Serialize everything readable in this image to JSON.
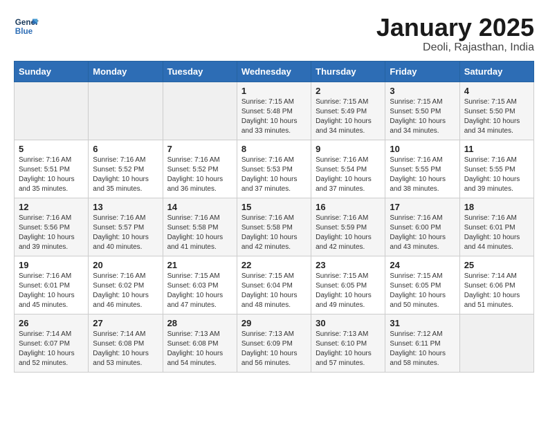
{
  "header": {
    "logo_line1": "General",
    "logo_line2": "Blue",
    "title": "January 2025",
    "location": "Deoli, Rajasthan, India"
  },
  "weekdays": [
    "Sunday",
    "Monday",
    "Tuesday",
    "Wednesday",
    "Thursday",
    "Friday",
    "Saturday"
  ],
  "weeks": [
    [
      {
        "day": "",
        "content": ""
      },
      {
        "day": "",
        "content": ""
      },
      {
        "day": "",
        "content": ""
      },
      {
        "day": "1",
        "content": "Sunrise: 7:15 AM\nSunset: 5:48 PM\nDaylight: 10 hours\nand 33 minutes."
      },
      {
        "day": "2",
        "content": "Sunrise: 7:15 AM\nSunset: 5:49 PM\nDaylight: 10 hours\nand 34 minutes."
      },
      {
        "day": "3",
        "content": "Sunrise: 7:15 AM\nSunset: 5:50 PM\nDaylight: 10 hours\nand 34 minutes."
      },
      {
        "day": "4",
        "content": "Sunrise: 7:15 AM\nSunset: 5:50 PM\nDaylight: 10 hours\nand 34 minutes."
      }
    ],
    [
      {
        "day": "5",
        "content": "Sunrise: 7:16 AM\nSunset: 5:51 PM\nDaylight: 10 hours\nand 35 minutes."
      },
      {
        "day": "6",
        "content": "Sunrise: 7:16 AM\nSunset: 5:52 PM\nDaylight: 10 hours\nand 35 minutes."
      },
      {
        "day": "7",
        "content": "Sunrise: 7:16 AM\nSunset: 5:52 PM\nDaylight: 10 hours\nand 36 minutes."
      },
      {
        "day": "8",
        "content": "Sunrise: 7:16 AM\nSunset: 5:53 PM\nDaylight: 10 hours\nand 37 minutes."
      },
      {
        "day": "9",
        "content": "Sunrise: 7:16 AM\nSunset: 5:54 PM\nDaylight: 10 hours\nand 37 minutes."
      },
      {
        "day": "10",
        "content": "Sunrise: 7:16 AM\nSunset: 5:55 PM\nDaylight: 10 hours\nand 38 minutes."
      },
      {
        "day": "11",
        "content": "Sunrise: 7:16 AM\nSunset: 5:55 PM\nDaylight: 10 hours\nand 39 minutes."
      }
    ],
    [
      {
        "day": "12",
        "content": "Sunrise: 7:16 AM\nSunset: 5:56 PM\nDaylight: 10 hours\nand 39 minutes."
      },
      {
        "day": "13",
        "content": "Sunrise: 7:16 AM\nSunset: 5:57 PM\nDaylight: 10 hours\nand 40 minutes."
      },
      {
        "day": "14",
        "content": "Sunrise: 7:16 AM\nSunset: 5:58 PM\nDaylight: 10 hours\nand 41 minutes."
      },
      {
        "day": "15",
        "content": "Sunrise: 7:16 AM\nSunset: 5:58 PM\nDaylight: 10 hours\nand 42 minutes."
      },
      {
        "day": "16",
        "content": "Sunrise: 7:16 AM\nSunset: 5:59 PM\nDaylight: 10 hours\nand 42 minutes."
      },
      {
        "day": "17",
        "content": "Sunrise: 7:16 AM\nSunset: 6:00 PM\nDaylight: 10 hours\nand 43 minutes."
      },
      {
        "day": "18",
        "content": "Sunrise: 7:16 AM\nSunset: 6:01 PM\nDaylight: 10 hours\nand 44 minutes."
      }
    ],
    [
      {
        "day": "19",
        "content": "Sunrise: 7:16 AM\nSunset: 6:01 PM\nDaylight: 10 hours\nand 45 minutes."
      },
      {
        "day": "20",
        "content": "Sunrise: 7:16 AM\nSunset: 6:02 PM\nDaylight: 10 hours\nand 46 minutes."
      },
      {
        "day": "21",
        "content": "Sunrise: 7:15 AM\nSunset: 6:03 PM\nDaylight: 10 hours\nand 47 minutes."
      },
      {
        "day": "22",
        "content": "Sunrise: 7:15 AM\nSunset: 6:04 PM\nDaylight: 10 hours\nand 48 minutes."
      },
      {
        "day": "23",
        "content": "Sunrise: 7:15 AM\nSunset: 6:05 PM\nDaylight: 10 hours\nand 49 minutes."
      },
      {
        "day": "24",
        "content": "Sunrise: 7:15 AM\nSunset: 6:05 PM\nDaylight: 10 hours\nand 50 minutes."
      },
      {
        "day": "25",
        "content": "Sunrise: 7:14 AM\nSunset: 6:06 PM\nDaylight: 10 hours\nand 51 minutes."
      }
    ],
    [
      {
        "day": "26",
        "content": "Sunrise: 7:14 AM\nSunset: 6:07 PM\nDaylight: 10 hours\nand 52 minutes."
      },
      {
        "day": "27",
        "content": "Sunrise: 7:14 AM\nSunset: 6:08 PM\nDaylight: 10 hours\nand 53 minutes."
      },
      {
        "day": "28",
        "content": "Sunrise: 7:13 AM\nSunset: 6:08 PM\nDaylight: 10 hours\nand 54 minutes."
      },
      {
        "day": "29",
        "content": "Sunrise: 7:13 AM\nSunset: 6:09 PM\nDaylight: 10 hours\nand 56 minutes."
      },
      {
        "day": "30",
        "content": "Sunrise: 7:13 AM\nSunset: 6:10 PM\nDaylight: 10 hours\nand 57 minutes."
      },
      {
        "day": "31",
        "content": "Sunrise: 7:12 AM\nSunset: 6:11 PM\nDaylight: 10 hours\nand 58 minutes."
      },
      {
        "day": "",
        "content": ""
      }
    ]
  ]
}
